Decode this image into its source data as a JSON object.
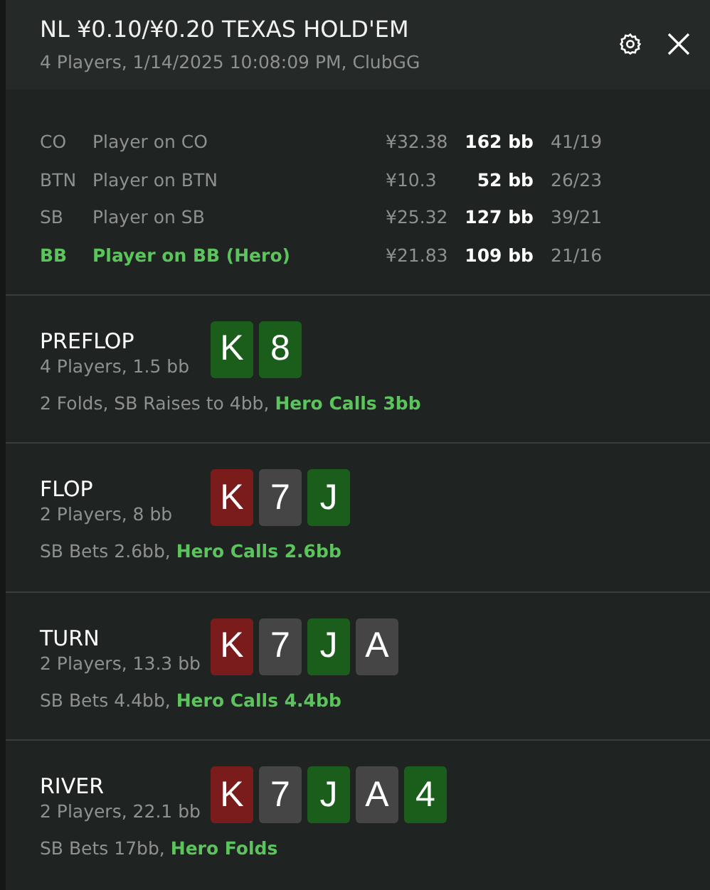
{
  "header": {
    "title": "NL ¥0.10/¥0.20 TEXAS HOLD'EM",
    "subtitle": "4 Players, 1/14/2025 10:08:09 PM, ClubGG"
  },
  "players": [
    {
      "position": "CO",
      "name": "Player on CO",
      "stack": "¥32.38",
      "bb": "162 bb",
      "stats": "41/19",
      "hero": false
    },
    {
      "position": "BTN",
      "name": "Player on BTN",
      "stack": "¥10.3",
      "bb": "52 bb",
      "stats": "26/23",
      "hero": false
    },
    {
      "position": "SB",
      "name": "Player on SB",
      "stack": "¥25.32",
      "bb": "127 bb",
      "stats": "39/21",
      "hero": false
    },
    {
      "position": "BB",
      "name": "Player on BB (Hero)",
      "stack": "¥21.83",
      "bb": "109 bb",
      "stats": "21/16",
      "hero": true
    }
  ],
  "streets": [
    {
      "name": "PREFLOP",
      "info": "4 Players, 1.5 bb",
      "cards": [
        {
          "rank": "K",
          "color": "#1b5e1b"
        },
        {
          "rank": "8",
          "color": "#1b5e1b"
        }
      ],
      "action": "2 Folds, SB Raises to 4bb,",
      "hero_action": "Hero Calls 3bb"
    },
    {
      "name": "FLOP",
      "info": "2 Players, 8 bb",
      "cards": [
        {
          "rank": "K",
          "color": "#7a1c1c"
        },
        {
          "rank": "7",
          "color": "#454545"
        },
        {
          "rank": "J",
          "color": "#1b5e1b"
        }
      ],
      "action": "SB Bets 2.6bb,",
      "hero_action": "Hero Calls 2.6bb"
    },
    {
      "name": "TURN",
      "info": "2 Players, 13.3 bb",
      "cards": [
        {
          "rank": "K",
          "color": "#7a1c1c"
        },
        {
          "rank": "7",
          "color": "#454545"
        },
        {
          "rank": "J",
          "color": "#1b5e1b"
        },
        {
          "rank": "A",
          "color": "#454545"
        }
      ],
      "action": "SB Bets 4.4bb,",
      "hero_action": "Hero Calls 4.4bb"
    },
    {
      "name": "RIVER",
      "info": "2 Players, 22.1 bb",
      "cards": [
        {
          "rank": "K",
          "color": "#7a1c1c"
        },
        {
          "rank": "7",
          "color": "#454545"
        },
        {
          "rank": "J",
          "color": "#1b5e1b"
        },
        {
          "rank": "A",
          "color": "#454545"
        },
        {
          "rank": "4",
          "color": "#1b5e1b"
        }
      ],
      "action": "SB Bets 17bb,",
      "hero_action": "Hero Folds"
    }
  ]
}
